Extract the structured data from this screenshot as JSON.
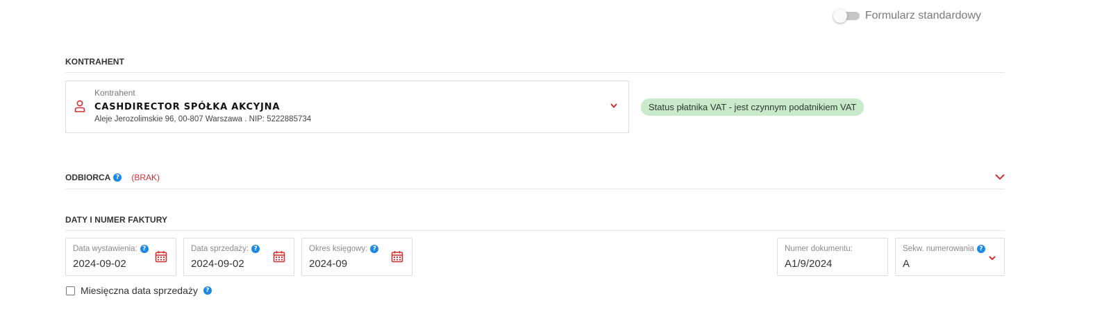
{
  "toggle": {
    "label": "Formularz standardowy",
    "on": false
  },
  "kontrahent_section": {
    "title": "KONTRAHENT",
    "field_label": "Kontrahent",
    "name": "CASHDIRECTOR SPÓŁKA AKCYJNA",
    "address": "Aleje Jerozolimskie 96, 00-807 Warszawa . NIP: 5222885734",
    "vat_status": "Status płatnika VAT - jest czynnym podatnikiem VAT"
  },
  "odbiorca_section": {
    "title": "ODBIORCA",
    "help": "?",
    "status": "(BRAK)"
  },
  "dates_section": {
    "title": "DATY I NUMER FAKTURY",
    "fields": [
      {
        "label": "Data wystawienia:",
        "value": "2024-09-02"
      },
      {
        "label": "Data sprzedaży:",
        "value": "2024-09-02"
      },
      {
        "label": "Okres księgowy:",
        "value": "2024-09"
      },
      {
        "label": "Numer dokumentu:",
        "value": "A1/9/2024"
      },
      {
        "label": "Sekw. numerowania",
        "value": "A"
      }
    ],
    "monthly_sale_date": {
      "label": "Miesięczna data sprzedaży",
      "checked": false
    }
  },
  "colors": {
    "accent_red": "#d32f2f",
    "help_blue": "#1e88e5",
    "vat_badge_bg": "#c9e9cb"
  },
  "icons": {
    "contractor": "person-icon",
    "date": "calendar-icon",
    "help": "help-icon",
    "expand": "chevron-down-icon"
  }
}
